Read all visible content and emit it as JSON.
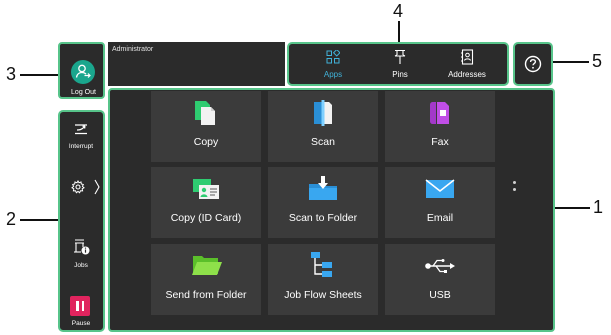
{
  "callouts": {
    "main_area": "1",
    "side_panel": "2",
    "logout": "3",
    "tabs": "4",
    "help": "5"
  },
  "header": {
    "user_name": "Administrator",
    "logout_label": "Log Out"
  },
  "tabs": [
    {
      "label": "Apps",
      "icon": "apps-icon",
      "active": true
    },
    {
      "label": "Pins",
      "icon": "pin-icon",
      "active": false
    },
    {
      "label": "Addresses",
      "icon": "address-book-icon",
      "active": false
    }
  ],
  "help": {
    "icon": "help-icon"
  },
  "sidebar": {
    "interrupt_label": "Interrupt",
    "settings_icon": "gear-icon",
    "jobs_label": "Jobs",
    "pause_label": "Pause"
  },
  "apps": [
    {
      "label": "Copy",
      "icon": "copy-icon"
    },
    {
      "label": "Scan",
      "icon": "scan-icon"
    },
    {
      "label": "Fax",
      "icon": "fax-icon"
    },
    {
      "label": "Copy (ID Card)",
      "icon": "id-card-icon"
    },
    {
      "label": "Scan to Folder",
      "icon": "scan-to-folder-icon"
    },
    {
      "label": "Email",
      "icon": "email-icon"
    },
    {
      "label": "Send from Folder",
      "icon": "folder-open-icon"
    },
    {
      "label": "Job Flow Sheets",
      "icon": "job-flow-icon"
    },
    {
      "label": "USB",
      "icon": "usb-icon"
    }
  ],
  "colors": {
    "highlight": "#57c48a",
    "accent": "#41b2d8",
    "tile": "#3b3b3b",
    "frame": "#2b2b2b",
    "pause": "#e0245e"
  }
}
